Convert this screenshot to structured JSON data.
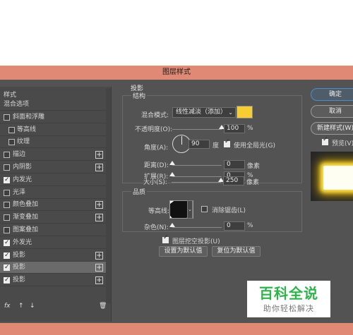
{
  "dialog": {
    "title": "图层样式"
  },
  "left_panel": {
    "header": "样式",
    "items": [
      {
        "label": "混合选项",
        "checkbox": false,
        "checked": false,
        "plus": false,
        "indent": false,
        "selected": false
      },
      {
        "label": "斜面和浮雕",
        "checkbox": true,
        "checked": false,
        "plus": false,
        "indent": false,
        "selected": false
      },
      {
        "label": "等高线",
        "checkbox": true,
        "checked": false,
        "plus": false,
        "indent": true,
        "selected": false
      },
      {
        "label": "纹理",
        "checkbox": true,
        "checked": false,
        "plus": false,
        "indent": true,
        "selected": false
      },
      {
        "label": "描边",
        "checkbox": true,
        "checked": false,
        "plus": true,
        "indent": false,
        "selected": false
      },
      {
        "label": "内阴影",
        "checkbox": true,
        "checked": false,
        "plus": true,
        "indent": false,
        "selected": false
      },
      {
        "label": "内发光",
        "checkbox": true,
        "checked": true,
        "plus": false,
        "indent": false,
        "selected": false
      },
      {
        "label": "光泽",
        "checkbox": true,
        "checked": false,
        "plus": false,
        "indent": false,
        "selected": false
      },
      {
        "label": "颜色叠加",
        "checkbox": true,
        "checked": false,
        "plus": true,
        "indent": false,
        "selected": false
      },
      {
        "label": "渐变叠加",
        "checkbox": true,
        "checked": false,
        "plus": true,
        "indent": false,
        "selected": false
      },
      {
        "label": "图案叠加",
        "checkbox": true,
        "checked": false,
        "plus": false,
        "indent": false,
        "selected": false
      },
      {
        "label": "外发光",
        "checkbox": true,
        "checked": true,
        "plus": false,
        "indent": false,
        "selected": false
      },
      {
        "label": "投影",
        "checkbox": true,
        "checked": true,
        "plus": true,
        "indent": false,
        "selected": false
      },
      {
        "label": "投影",
        "checkbox": true,
        "checked": true,
        "plus": true,
        "indent": false,
        "selected": true
      },
      {
        "label": "投影",
        "checkbox": true,
        "checked": true,
        "plus": true,
        "indent": false,
        "selected": false
      }
    ],
    "bottom": {
      "fx": "fx",
      "up": "↑",
      "down": "↓",
      "trash": "🗑"
    }
  },
  "drop_shadow": {
    "section_title": "投影",
    "structure_title": "结构",
    "blend_mode_label": "混合模式:",
    "blend_mode_value": "线性减淡（添加）",
    "shadow_color": "#f6ce34",
    "opacity_label": "不透明度(O):",
    "opacity_value": "100",
    "opacity_level": 1.0,
    "opacity_unit": "%",
    "angle_label": "角度(A):",
    "angle_value": "90",
    "angle_unit": "度",
    "global_light_label": "使用全局光(G)",
    "global_light_checked": true,
    "distance_label": "距离(D):",
    "distance_value": "0",
    "distance_unit": "像素",
    "spread_label": "扩展(R):",
    "spread_value": "0",
    "spread_unit": "%",
    "size_label": "大小(S):",
    "size_value": "250",
    "size_level": 1.0,
    "size_unit": "像素",
    "quality_title": "品质",
    "contour_label": "等高线:",
    "antialias_label": "消除锯齿(L)",
    "antialias_checked": false,
    "noise_label": "杂色(N):",
    "noise_value": "0",
    "noise_unit": "%",
    "knockout_label": "图层挖空投影(U)",
    "knockout_checked": true,
    "make_default_label": "设置为默认值",
    "reset_default_label": "复位为默认值"
  },
  "right_panel": {
    "ok_label": "确定",
    "cancel_label": "取消",
    "new_style_label": "新建样式(W)",
    "preview_label": "预览(V)",
    "preview_checked": true
  },
  "watermark": {
    "main": "百科全说",
    "sub": "助你轻松解决"
  }
}
